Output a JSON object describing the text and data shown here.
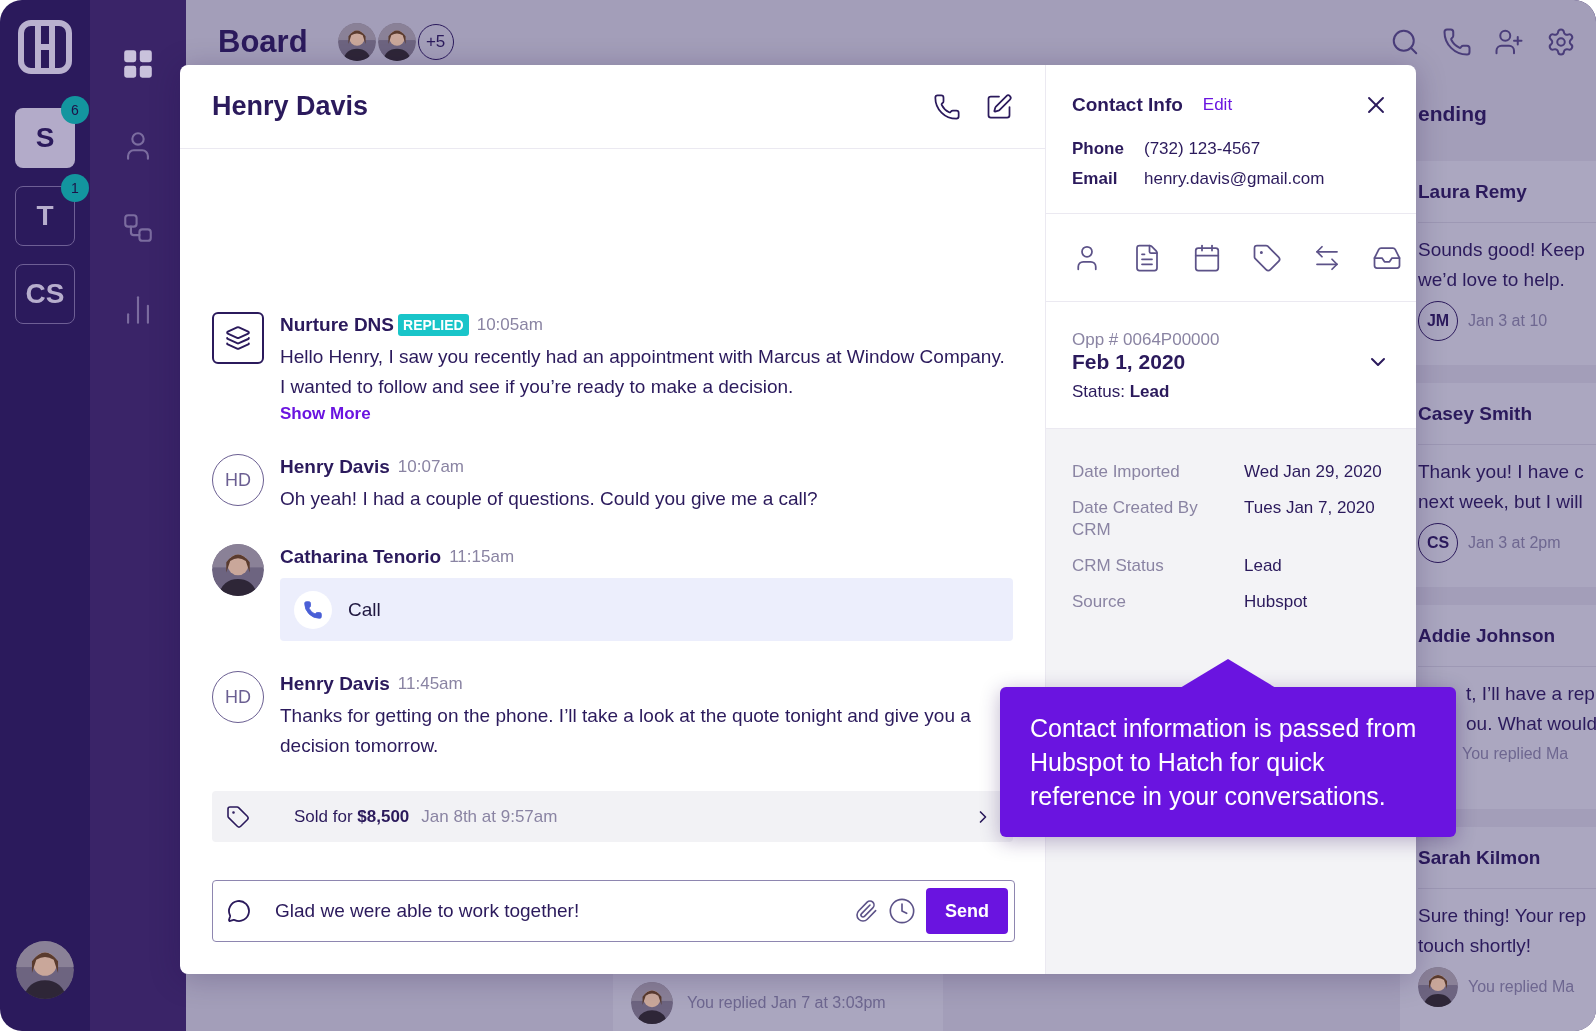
{
  "workspaces": [
    {
      "label": "S",
      "selected": true,
      "badge": "6"
    },
    {
      "label": "T",
      "selected": false,
      "badge": "1"
    },
    {
      "label": "CS",
      "selected": false
    }
  ],
  "nav": [
    {
      "selected": true
    },
    {
      "selected": false
    },
    {
      "selected": false
    },
    {
      "selected": false
    }
  ],
  "header": {
    "title": "Board",
    "more_members": "+5"
  },
  "board": {
    "column_title": "ending",
    "cards": [
      {
        "name": "Laura Remy",
        "lines": [
          "Sounds good! Keep",
          "we’d love to help."
        ],
        "footer": {
          "kind": "initials",
          "initials": "JM",
          "text": "Jan 3 at 10"
        },
        "covered": false
      },
      {
        "name": "Casey Smith",
        "lines": [
          "Thank you! I have c",
          "next week, but I will"
        ],
        "footer": {
          "kind": "initials",
          "initials": "CS",
          "text": "Jan 3 at 2pm"
        },
        "covered": false
      },
      {
        "name": "Addie Johnson",
        "lines": [
          "t, I’ll have a rep",
          "ou. What would"
        ],
        "footer": {
          "text": "You replied Ma"
        },
        "covered": true
      },
      {
        "name": "Sarah Kilmon",
        "lines": [
          "Sure thing! Your rep",
          "touch shortly!"
        ],
        "footer": {
          "text": "You replied Ma"
        },
        "covered": false
      }
    ],
    "hidden_card": {
      "footer": "You replied Jan 7 at 3:03pm"
    }
  },
  "conversation": {
    "title": "Henry Davis",
    "messages": [
      {
        "kind": "bot",
        "author": "Nurture DNS",
        "badge": "REPLIED",
        "time": "10:05am",
        "text": "Hello Henry, I saw you recently had an appointment with Marcus at Window Company.  I wanted to follow and see if you’re ready to make a decision.",
        "link": "Show More"
      },
      {
        "kind": "contact",
        "initials": "HD",
        "author": "Henry Davis",
        "time": "10:07am",
        "text": "Oh yeah! I had a couple of questions. Could you give me a call?"
      },
      {
        "kind": "call",
        "author": "Catharina Tenorio",
        "time": "11:15am",
        "text": "Call"
      },
      {
        "kind": "contact",
        "initials": "HD",
        "author": "Henry Davis",
        "time": "11:45am",
        "text": "Thanks for getting on the phone. I’ll take a look at the quote tonight and give you a decision tomorrow."
      }
    ],
    "sale": {
      "label": "Sold for **$8,500**",
      "time": "Jan 8th at 9:57am"
    },
    "composer": {
      "value": "Glad we were able to work together!",
      "send": "Send"
    }
  },
  "contact": {
    "title": "Contact Info",
    "edit": "Edit",
    "fields": [
      {
        "label": "Phone",
        "value": "(732) 123-4567"
      },
      {
        "label": "Email",
        "value": "henry.davis@gmail.com"
      }
    ],
    "opportunity": {
      "number": "Opp # 0064P00000",
      "date": "Feb 1, 2020",
      "status": "Status: **Lead**"
    },
    "details": [
      {
        "label": "Date Imported",
        "value": "Wed Jan 29, 2020"
      },
      {
        "label": "Date Created By CRM",
        "value": "Tues Jan 7, 2020"
      },
      {
        "label": "CRM Status",
        "value": "Lead"
      },
      {
        "label": "Source",
        "value": "Hubspot"
      }
    ]
  },
  "tooltip": {
    "text": "Contact information is passed from Hubspot to Hatch for quick reference in your conversations."
  }
}
